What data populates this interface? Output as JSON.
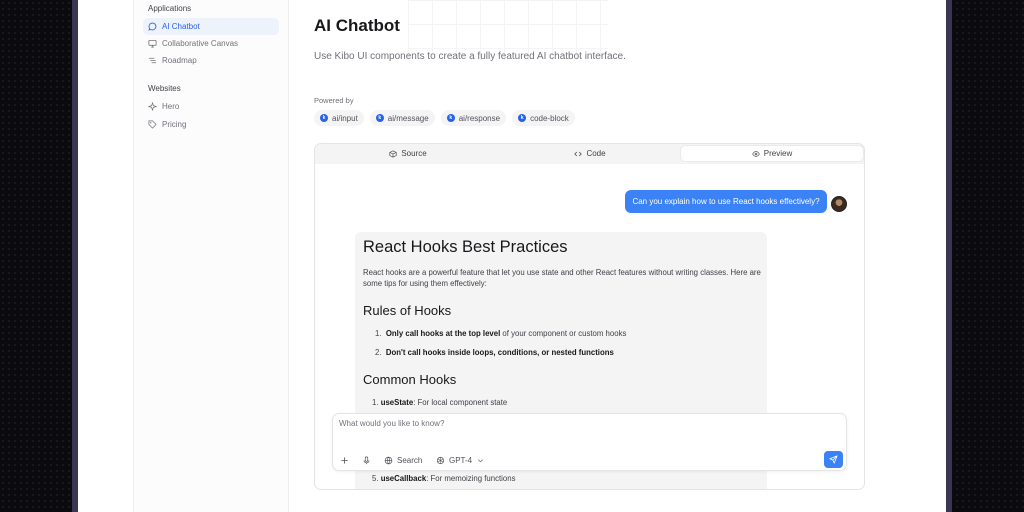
{
  "sidebar": {
    "groups": [
      {
        "title": "Applications",
        "items": [
          {
            "label": "AI Chatbot",
            "icon": "message-circle-icon",
            "active": true
          },
          {
            "label": "Collaborative Canvas",
            "icon": "monitor-icon"
          },
          {
            "label": "Roadmap",
            "icon": "list-icon"
          }
        ]
      },
      {
        "title": "Websites",
        "items": [
          {
            "label": "Hero",
            "icon": "sparkles-icon"
          },
          {
            "label": "Pricing",
            "icon": "tag-icon"
          }
        ]
      }
    ]
  },
  "page": {
    "title": "AI Chatbot",
    "description": "Use Kibo UI components to create a fully featured AI chatbot interface.",
    "powered_by": "Powered by",
    "chips": [
      "ai/input",
      "ai/message",
      "ai/response",
      "code-block"
    ]
  },
  "demo": {
    "tabs": [
      {
        "label": "Source",
        "icon": "box-icon"
      },
      {
        "label": "Code",
        "icon": "code-icon"
      },
      {
        "label": "Preview",
        "icon": "eye-icon",
        "active": true
      }
    ],
    "user_message": "Can you explain how to use React hooks effectively?",
    "response": {
      "h1": "React Hooks Best Practices",
      "intro": "React hooks are a powerful feature that let you use state and other React features without writing classes. Here are some tips for using them effectively:",
      "h2_rules": "Rules of Hooks",
      "rules": [
        {
          "num": "1.",
          "bold": "Only call hooks at the top level",
          "rest": " of your component or custom hooks"
        },
        {
          "num": "2.",
          "bold": "Don't call hooks inside loops, conditions, or nested functions",
          "rest": ""
        }
      ],
      "h2_common": "Common Hooks",
      "common": [
        {
          "num": "1.",
          "bold": "useState",
          "rest": ": For local component state"
        },
        {
          "num": "5.",
          "bold": "useCallback",
          "rest": ": For memoizing functions"
        }
      ]
    },
    "input": {
      "placeholder": "What would you like to know?",
      "search_label": "Search",
      "model_label": "GPT-4"
    }
  },
  "colors": {
    "accent": "#3b82f6",
    "active_bg": "#eef2fb",
    "border": "#3a3550"
  }
}
